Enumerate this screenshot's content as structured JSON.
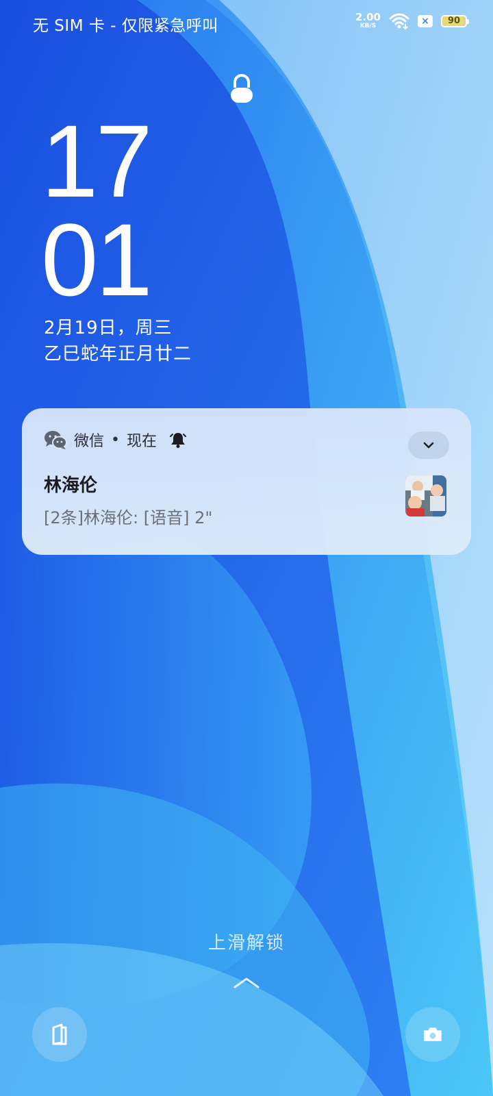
{
  "status_bar": {
    "carrier": "无 SIM 卡 - 仅限紧急呼叫",
    "net_speed_value": "2.00",
    "net_speed_unit": "KB/S",
    "sim_badge": "×",
    "battery_percent": "90",
    "battery_level": 0.9
  },
  "clock": {
    "hours": "17",
    "minutes": "01",
    "date": "2月19日，周三",
    "lunar_date": "乙巳蛇年正月廿二"
  },
  "notification": {
    "app_name": "微信",
    "separator": "•",
    "time": "现在",
    "title": "林海伦",
    "body": "[2条]林海伦: [语音] 2\"",
    "icons": {
      "app": "wechat-icon",
      "alert": "bell-icon",
      "expand": "chevron-down-icon"
    }
  },
  "lock_screen": {
    "swipe_hint": "上滑解锁",
    "left_shortcut_icon": "phone-icon",
    "right_shortcut_icon": "camera-icon"
  },
  "colors": {
    "wallpaper_primary": "#1f5fe8",
    "wallpaper_secondary": "#4fb6f7",
    "notification_bg": "#dbe7fa"
  }
}
